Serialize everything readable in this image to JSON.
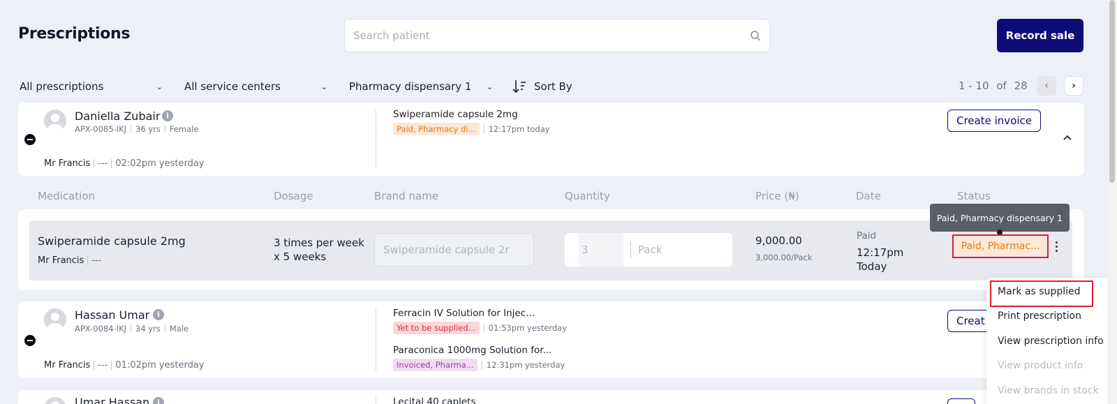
{
  "header": {
    "title": "Prescriptions",
    "search_placeholder": "Search patient",
    "record_sale_label": "Record sale"
  },
  "filters": {
    "prescriptions": "All prescriptions",
    "service_centers": "All service centers",
    "dispensary": "Pharmacy dispensary 1",
    "sort_label": "Sort By"
  },
  "pagination": {
    "range": "1 - 10",
    "of_label": "of",
    "total": "28",
    "prev": "‹",
    "next": "›"
  },
  "patients": [
    {
      "name": "Daniella Zubair",
      "id": "APX-0085-IKJ",
      "age": "36 yrs",
      "gender": "Female",
      "doctor": "Mr Francis",
      "doctor_extra": "---",
      "time": "02:02pm yesterday",
      "create_invoice_label": "Create invoice",
      "medications": [
        {
          "name": "Swiperamide capsule 2mg",
          "status": "Paid, Pharmacy di...",
          "time": "12:17pm today"
        }
      ]
    },
    {
      "name": "Hassan Umar",
      "id": "APX-0084-IKJ",
      "age": "34 yrs",
      "gender": "Male",
      "doctor": "Mr Francis",
      "doctor_extra": "---",
      "time": "01:02pm yesterday",
      "create_invoice_label": "Creat",
      "medications": [
        {
          "name": "Ferracin IV Solution for Injec...",
          "status": "Yet to be supplied...",
          "time": "01:53pm yesterday"
        },
        {
          "name": "Paraconica 1000mg Solution for...",
          "status": "Invoiced, Pharma...",
          "time": "12:31pm yesterday"
        }
      ]
    },
    {
      "name": "Umar Hassan",
      "medications": [
        {
          "name": "Lecital 40 caplets"
        }
      ]
    }
  ],
  "table_headers": {
    "medication": "Medication",
    "dosage": "Dosage",
    "brand": "Brand name",
    "quantity": "Quantity",
    "price": "Price (₦)",
    "date": "Date",
    "status": "Status"
  },
  "detail_row": {
    "medication": "Swiperamide capsule 2mg",
    "doctor": "Mr Francis",
    "doctor_extra": "---",
    "dosage_line1": "3 times per week",
    "dosage_line2": "x 5 weeks",
    "brand_placeholder": "Swiperamide capsule 2r",
    "quantity_value": "3",
    "quantity_unit": "Pack",
    "price": "9,000.00",
    "unit_price": "3,000.00/Pack",
    "date_status": "Paid",
    "date_time": "12:17pm",
    "date_day": "Today",
    "status": "Paid, Pharmac...",
    "tooltip": "Paid, Pharmacy dispensary 1"
  },
  "menu": {
    "items": [
      {
        "label": "Mark as supplied",
        "enabled": true
      },
      {
        "label": "Print prescription",
        "enabled": true
      },
      {
        "label": "View prescription info",
        "enabled": true
      },
      {
        "label": "View product info",
        "enabled": false
      },
      {
        "label": "View brands in stock",
        "enabled": false
      }
    ]
  },
  "colors": {
    "primary": "#0e0a78",
    "background": "#eef0f8",
    "highlight": "#e11d2a",
    "tag_orange": "#e27a1a",
    "tag_red": "#d8303d",
    "tag_purple": "#a13aa6"
  }
}
